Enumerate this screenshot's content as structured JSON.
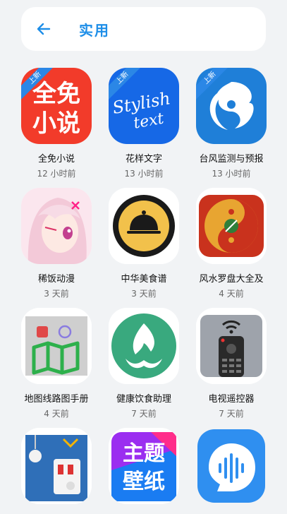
{
  "header": {
    "title": "实用"
  },
  "badge_label": "上新",
  "apps": [
    {
      "name": "全免小说",
      "time": "12 小时前",
      "icon": "novel-icon",
      "new": true,
      "text1": "全免",
      "text2": "小说"
    },
    {
      "name": "花样文字",
      "time": "13 小时前",
      "icon": "stylish-text-icon",
      "new": true,
      "text1": "Stylish",
      "text2": "text"
    },
    {
      "name": "台风监测与预报",
      "time": "13 小时前",
      "icon": "typhoon-icon",
      "new": true
    },
    {
      "name": "稀饭动漫",
      "time": "3 天前",
      "icon": "anime-girl-icon",
      "new": false
    },
    {
      "name": "中华美食谱",
      "time": "3 天前",
      "icon": "food-cloche-icon",
      "new": false
    },
    {
      "name": "风水罗盘大全及",
      "time": "4 天前",
      "icon": "fengshui-compass-icon",
      "new": false
    },
    {
      "name": "地图线路图手册",
      "time": "4 天前",
      "icon": "map-route-icon",
      "new": false
    },
    {
      "name": "健康饮食助理",
      "time": "7 天前",
      "icon": "healthy-diet-icon",
      "new": false
    },
    {
      "name": "电视遥控器",
      "time": "7 天前",
      "icon": "tv-remote-icon",
      "new": false
    },
    {
      "name": "",
      "time": "",
      "icon": "electric-bulb-icon",
      "new": false
    },
    {
      "name": "",
      "time": "",
      "icon": "theme-wallpaper-icon",
      "new": false,
      "text1": "主题",
      "text2": "壁纸"
    },
    {
      "name": "",
      "time": "",
      "icon": "voice-wave-icon",
      "new": false
    }
  ],
  "colors": {
    "accent": "#1e8ee8",
    "badge": "#2b87e6"
  }
}
